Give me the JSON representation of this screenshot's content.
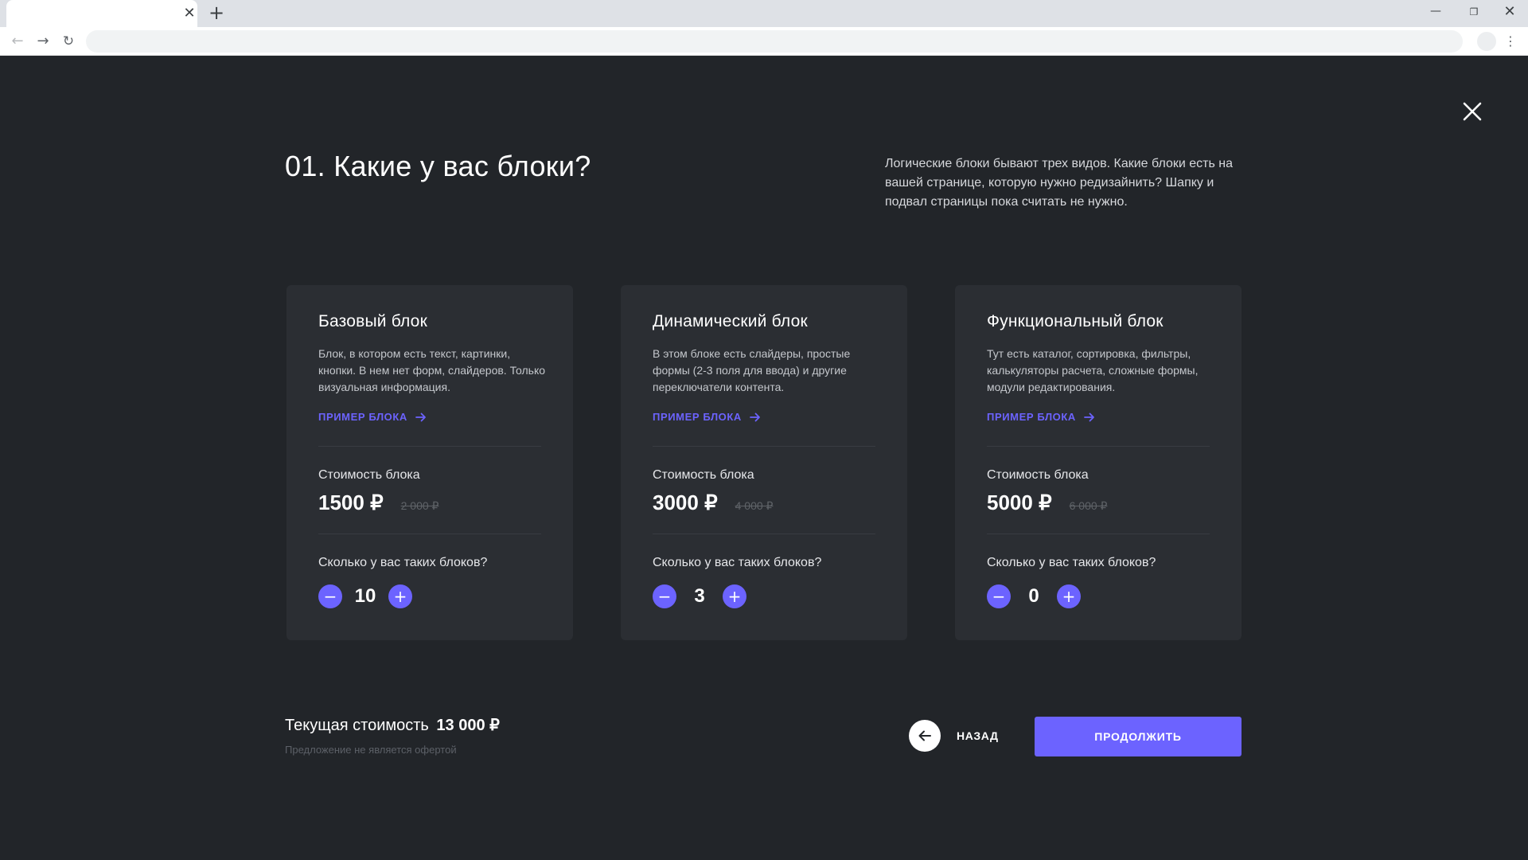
{
  "browser": {
    "tab_close_icon": "✕",
    "new_tab_icon": "+",
    "back_icon": "←",
    "forward_icon": "→",
    "reload_icon": "↻",
    "menu_icon": "⋮",
    "minimize_icon": "—",
    "maximize_icon": "❐",
    "window_close_icon": "✕"
  },
  "header": {
    "title": "01. Какие у вас блоки?",
    "intro": "Логические блоки бывают трех видов. Какие блоки есть на вашей странице, которую нужно редизайнить? Шапку и подвал страницы пока считать не нужно.",
    "close_icon": "close-icon"
  },
  "cards": [
    {
      "title": "Базовый блок",
      "description": "Блок, в котором есть текст, картинки, кнопки. В нем нет форм, слайдеров. Только визуальная информация.",
      "link_label": "ПРИМЕР БЛОКА",
      "cost_label": "Стоимость блока",
      "price": "1500 ₽",
      "old_price": "2 000 ₽",
      "quantity_label": "Сколько у вас таких блоков?",
      "minus_icon": "−",
      "plus_icon": "+",
      "quantity": "10"
    },
    {
      "title": "Динамический блок",
      "description": "В этом блоке есть слайдеры, простые формы (2-3 поля для ввода) и другие переключатели контента.",
      "link_label": "ПРИМЕР БЛОКА",
      "cost_label": "Стоимость блока",
      "price": "3000 ₽",
      "old_price": "4 000 ₽",
      "quantity_label": "Сколько у вас таких блоков?",
      "minus_icon": "−",
      "plus_icon": "+",
      "quantity": "3"
    },
    {
      "title": "Функциональный блок",
      "description": "Тут есть каталог, сортировка, фильтры, калькуляторы расчета, сложные формы, модули редактирования.",
      "link_label": "ПРИМЕР БЛОКА",
      "cost_label": "Стоимость блока",
      "price": "5000 ₽",
      "old_price": "6 000 ₽",
      "quantity_label": "Сколько у вас таких блоков?",
      "minus_icon": "−",
      "plus_icon": "+",
      "quantity": "0"
    }
  ],
  "footer": {
    "total_label": "Текущая стоимость",
    "total_value": "13 000 ₽",
    "disclaimer": "Предложение не является офертой",
    "back_label": "НАЗАД",
    "continue_label": "ПРОДОЛЖИТЬ"
  },
  "colors": {
    "background": "#222529",
    "card": "#2b2e33",
    "accent": "#6c63ff",
    "muted_text": "#5c6067"
  }
}
